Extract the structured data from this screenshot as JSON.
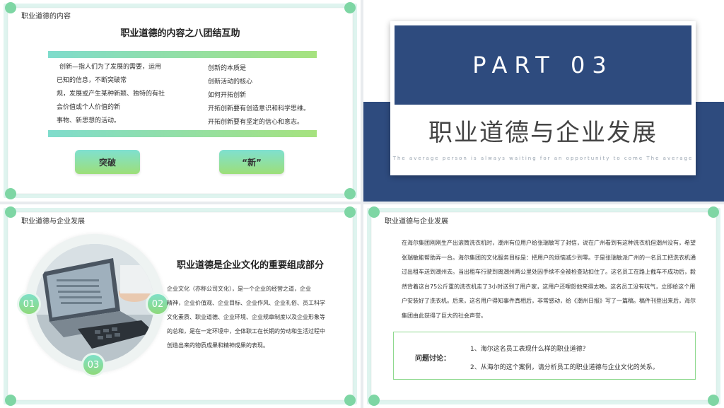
{
  "slide1": {
    "section": "职业道德的内容",
    "title": "职业道德的内容之八团结互助",
    "left_lines": [
      "创新—指人们为了发展的需要，运用",
      "已知的信息，不断突破常",
      "规，发展或产生某种新颖、独特的有社",
      "会价值或个人价值的新",
      "事物、新思想的活动。"
    ],
    "right_lines": [
      "创新的本质是",
      "创新活动的核心",
      "如何开拓创新",
      "开拓创新要有创造意识和科学思维。",
      "开拓创新要有坚定的信心和意志。"
    ],
    "button_a": "突破",
    "button_b": "“新”"
  },
  "slide2": {
    "part": "PART 03",
    "title": "职业道德与企业发展",
    "subtitle": "The average person is always waiting for an opportunity to come The average"
  },
  "slide3": {
    "section": "职业道德与企业发展",
    "heading": "职业道德是企业文化的重要组成部分",
    "badges": [
      "01",
      "02",
      "03"
    ],
    "body_lines": [
      "企业文化（亦称公司文化），是一个企业的经营之道，企业",
      "精神，企业价值观、企业目标、企业作风、企业礼俗、员工科学",
      "文化素质、职业道德、企业环境、企业规章制度以及企业形象等",
      "的总和，是在一定环境中，全体职工在长期的劳动和生活过程中",
      "创造出来的物质成果和精神成果的表现。"
    ]
  },
  "slide4": {
    "section": "职业道德与企业发展",
    "story_lines": [
      "在海尔集团刚刚生产出滚筒洗衣机时，潮州有位用户给张瑞敏写了封信，说在广州看到有这种洗衣机但潮州没有，希望",
      "张瑞敏能帮助弄一台。海尔集团的文化服务目标是：把用户的烦恼减少到零。于是张瑞敏派广州的一名员工把洗衣机通",
      "过出租车送到潮州去。当出租车行驶到离潮州两公里处因手续不全被检查站扣住了。这名员工在路上截车不成功后，毅",
      "然背着这台75公斤重的洗衣机走了3小时送到了用户家，这用户还哩怨他来得太晚。这名员工没有吭气，立即给这个用",
      "户安装好了洗衣机。后来，这名用户得知事件真相后，非常感动，给《潮州日报》写了一篇稿。稿件刊登出来后，海尔",
      "集团由此获得了巨大的社会声誉。"
    ],
    "discussion_label": "问题讨论：",
    "questions": [
      "1、海尔这名员工表现什么样的职业道德？",
      "2、从海尔的这个案例，请分析员工的职业道德与企业文化的关系。"
    ]
  },
  "colors": {
    "accent_green": "#7ed6a4",
    "navy": "#2e4b7e",
    "frame_teal": "#dff4ef"
  }
}
